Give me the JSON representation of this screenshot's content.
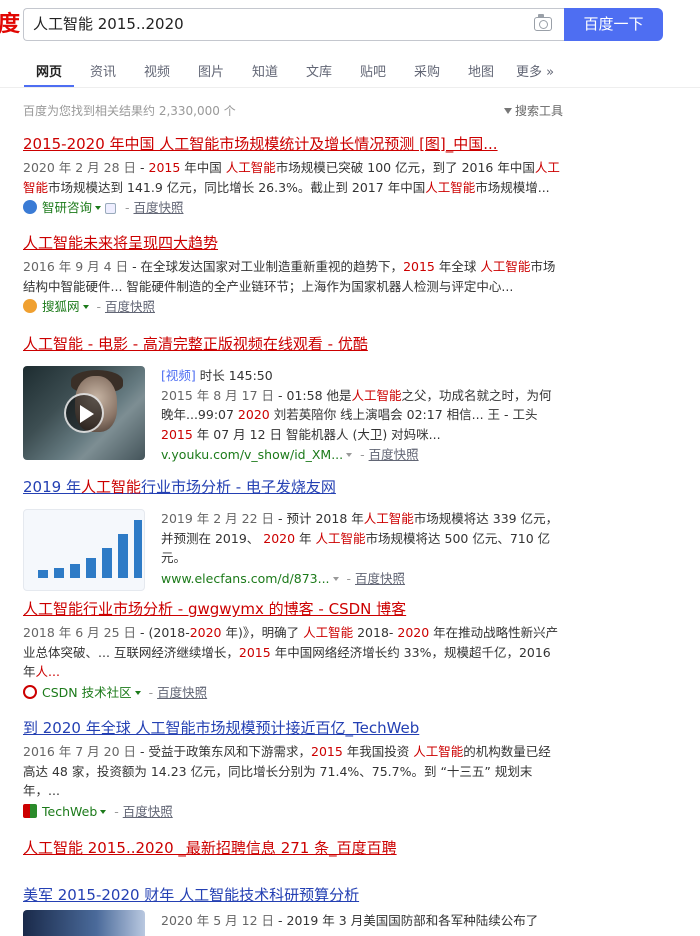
{
  "header": {
    "logo_text": "度",
    "search_query": "人工智能 2015..2020",
    "search_button": "百度一下"
  },
  "tabs": [
    {
      "label": "网页",
      "active": true
    },
    {
      "label": "资讯"
    },
    {
      "label": "视频"
    },
    {
      "label": "图片"
    },
    {
      "label": "知道"
    },
    {
      "label": "文库"
    },
    {
      "label": "贴吧"
    },
    {
      "label": "采购"
    },
    {
      "label": "地图"
    },
    {
      "label": "更多 »"
    }
  ],
  "result_count": "百度为您找到相关结果约 2,330,000 个",
  "search_tools": "搜索工具",
  "results": {
    "r1": {
      "title_a": "2015-2020 年中国 人工智能市场规模统计及增长情况预测 [图]_中国...",
      "date": "2020 年 2 月 28 日",
      "abs_a": " - ",
      "hl1": "2015",
      "abs_b": " 年中国 ",
      "hl2": "人工智能",
      "abs_c": "市场规模已突破 100 亿元，到了 2016 年中国",
      "hl3": "人工智能",
      "abs_d": "市场规模达到 141.9 亿元，同比增长 26.3%。截止到 2017 年中国",
      "hl4": "人工智能",
      "abs_e": "市场规模增...",
      "site": "智研咨询",
      "cache": "百度快照"
    },
    "r2": {
      "title_a": "人工智能未来将呈现四大趋势",
      "date": "2016 年 9 月 4 日",
      "abs_a": " - 在全球发达国家对工业制造重新重视的趋势下，",
      "hl1": "2015",
      "abs_b": " 年全球 ",
      "hl2": "人工智能",
      "abs_c": "市场结构中智能硬件... 智能硬件制造的全产业链环节；上海作为国家机器人检测与评定中心...",
      "site": "搜狐网",
      "cache": "百度快照"
    },
    "r3": {
      "title_a": "人工智能 - 电影 - 高清完整正版视频在线观看 - 优酷",
      "video_tag": "[视频]",
      "duration": " 时长 145:50",
      "date": "2015 年 8 月 17 日",
      "abs_a": " - 01:58 他是",
      "hl1": "人工智能",
      "abs_b": "之父，功成名就之时，为何晚年...99:07 ",
      "hl2": "2020",
      "abs_c": " 刘若英陪你 线上演唱会 02:17 相信... 王 - 工头 ",
      "hl3": "2015",
      "abs_d": " 年 07 月 12 日 智能机器人 (大卫) 对妈咪...",
      "url": "v.youku.com/v_show/id_XM...",
      "cache": "百度快照"
    },
    "r4": {
      "title_a": "2019 年",
      "title_hl": "人工智能",
      "title_b": "行业市场分析 - 电子发烧友网",
      "date": "2019 年 2 月 22 日",
      "abs_a": " - 预计 2018 年",
      "hl1": "人工智能",
      "abs_b": "市场规模将达 339 亿元，并预测在 2019、 ",
      "hl2": "2020",
      "abs_c": " 年 ",
      "hl3": "人工智能",
      "abs_d": "市场规模将达 500 亿元、710 亿元。",
      "url": "www.elecfans.com/d/873...",
      "cache": "百度快照"
    },
    "r5": {
      "title_a": "人工智能行业市场分析 - gwgwymx 的博客 - CSDN 博客",
      "date": "2018 年 6 月 25 日",
      "abs_a": " - (2018-",
      "hl1": "2020",
      "abs_b": " 年)》，明确了 ",
      "hl2": "人工智能",
      "abs_c": " 2018- ",
      "hl3": "2020",
      "abs_d": " 年在推动战略性新兴产业总体突破、... 互联网经济继续增长，",
      "hl4": "2015",
      "abs_e": " 年中国网络经济增长约 33%，规模超千亿，2016 年",
      "hl5": "人...",
      "site": "CSDN 技术社区",
      "cache": "百度快照"
    },
    "r6": {
      "title_a": "到 2020 年全球 人工智能市场规模预计接近百亿_TechWeb",
      "date": "2016 年 7 月 20 日",
      "abs_a": " - 受益于政策东风和下游需求，",
      "hl1": "2015",
      "abs_b": " 年我国投资 ",
      "hl2": "人工智能",
      "abs_c": "的机构数量已经高达 48 家，投资额为 14.23 亿元，同比增长分别为 71.4%、75.7%。到 “十三五” 规划末年，...",
      "site": "TechWeb",
      "cache": "百度快照"
    },
    "r7": {
      "title_a": "人工智能 2015..2020 _最新招聘信息 271 条_百度百聘"
    },
    "r8": {
      "title_a": "美军 2015-2020 财年 人工智能技术科研预算分析",
      "date": "2020 年 5 月 12 日",
      "abs_a": " - 2019 年 3 月美国国防部和各军种陆续公布了"
    }
  }
}
